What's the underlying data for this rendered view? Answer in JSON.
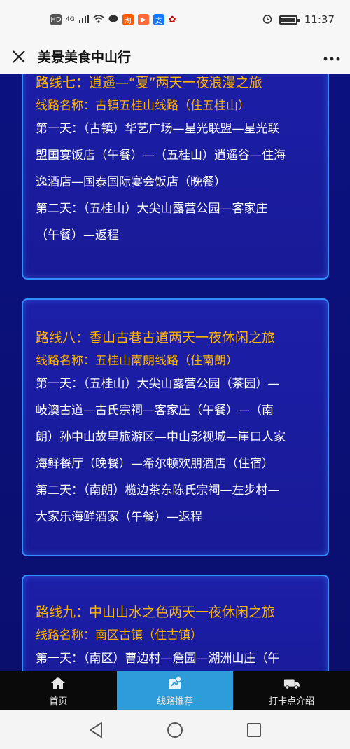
{
  "status_bar": {
    "left_badges": [
      "HD",
      "4G"
    ],
    "time": "11:37"
  },
  "title_bar": {
    "title": "美景美食中山行"
  },
  "routes": [
    {
      "title": "路线七：逍遥—“夏”两天一夜浪漫之旅",
      "name": "线路名称：古镇五桂山线路（住五桂山）",
      "days": [
        "第一天：（古镇）华艺广场—星光联盟—星光联",
        "盟国宴饭店（午餐）—（五桂山）逍遥谷—住海",
        "逸酒店—国泰国际宴会饭店（晚餐）",
        "第二天：（五桂山）大尖山露营公园—客家庄",
        "（午餐）—返程"
      ]
    },
    {
      "title": "路线八：香山古巷古道两天一夜休闲之旅",
      "name": "线路名称：五桂山南朗线路（住南朗）",
      "days": [
        "第一天：（五桂山）大尖山露营公园（茶园）—",
        "岐澳古道—古氏宗祠—客家庄（午餐）—（南",
        "朗）孙中山故里旅游区—中山影视城—崖口人家",
        "海鲜餐厅（晚餐）—希尔顿欢朋酒店（住宿）",
        "第二天：（南朗）榄边茶东陈氏宗祠—左步村—",
        "大家乐海鲜酒家（午餐）—返程"
      ]
    },
    {
      "title": "路线九：中山山水之色两天一夜休闲之旅",
      "name": "线路名称：南区古镇（住古镇）",
      "days": [
        "第一天：（南区）曹边村—詹园—湖洲山庄（午"
      ]
    }
  ],
  "bottom_nav": [
    {
      "label": "首页",
      "icon": "home-icon"
    },
    {
      "label": "线路推荐",
      "icon": "route-icon"
    },
    {
      "label": "打卡点介绍",
      "icon": "checkin-icon"
    }
  ],
  "colors": {
    "accent_gold": "#ffb400",
    "card_border": "#2f8fff",
    "nav_active": "#2e9cd8"
  }
}
